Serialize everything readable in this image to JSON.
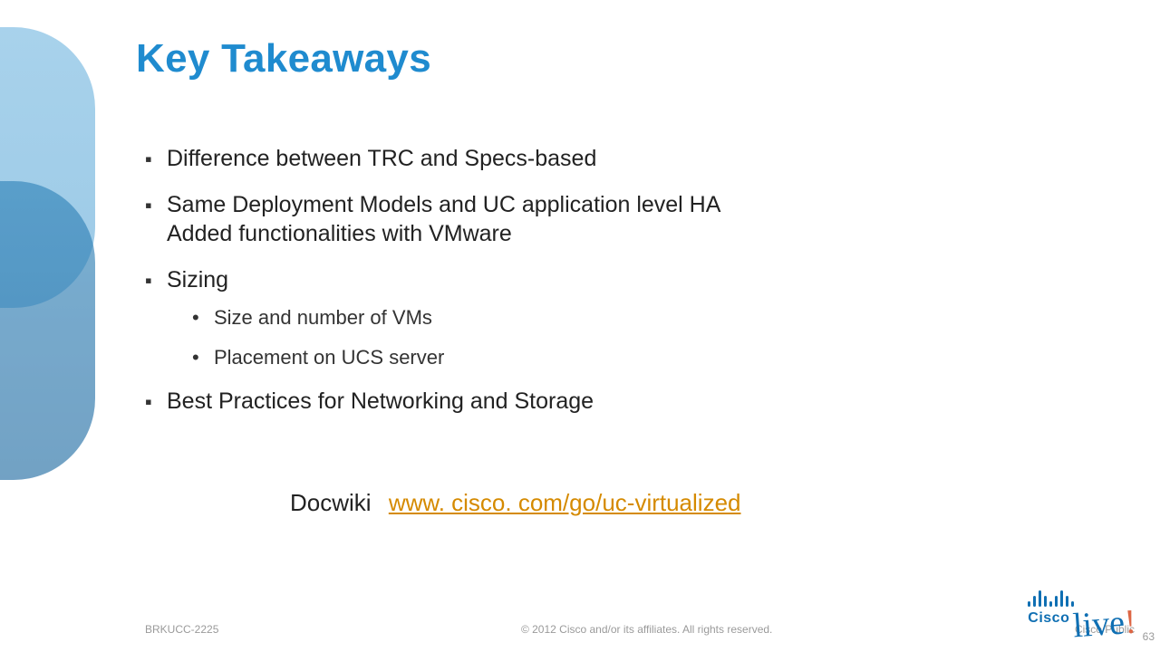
{
  "title": "Key Takeaways",
  "bullets": {
    "b1": "Difference between TRC and Specs-based",
    "b2_line1": "Same Deployment Models and UC application level HA",
    "b2_line2": "Added functionalities with VMware",
    "b3": "Sizing",
    "b3_sub1": "Size and number of VMs",
    "b3_sub2": "Placement on UCS server",
    "b4": "Best Practices for Networking and Storage"
  },
  "docwiki": {
    "label": "Docwiki",
    "link_text": "www. cisco. com/go/uc-virtualized"
  },
  "footer": {
    "session_code": "BRKUCC-2225",
    "copyright": "© 2012 Cisco and/or its affiliates. All rights reserved.",
    "public": "Cisco Public"
  },
  "brand": {
    "cisco": "Cisco",
    "live": "live",
    "bang": "!"
  },
  "page_number": "63"
}
